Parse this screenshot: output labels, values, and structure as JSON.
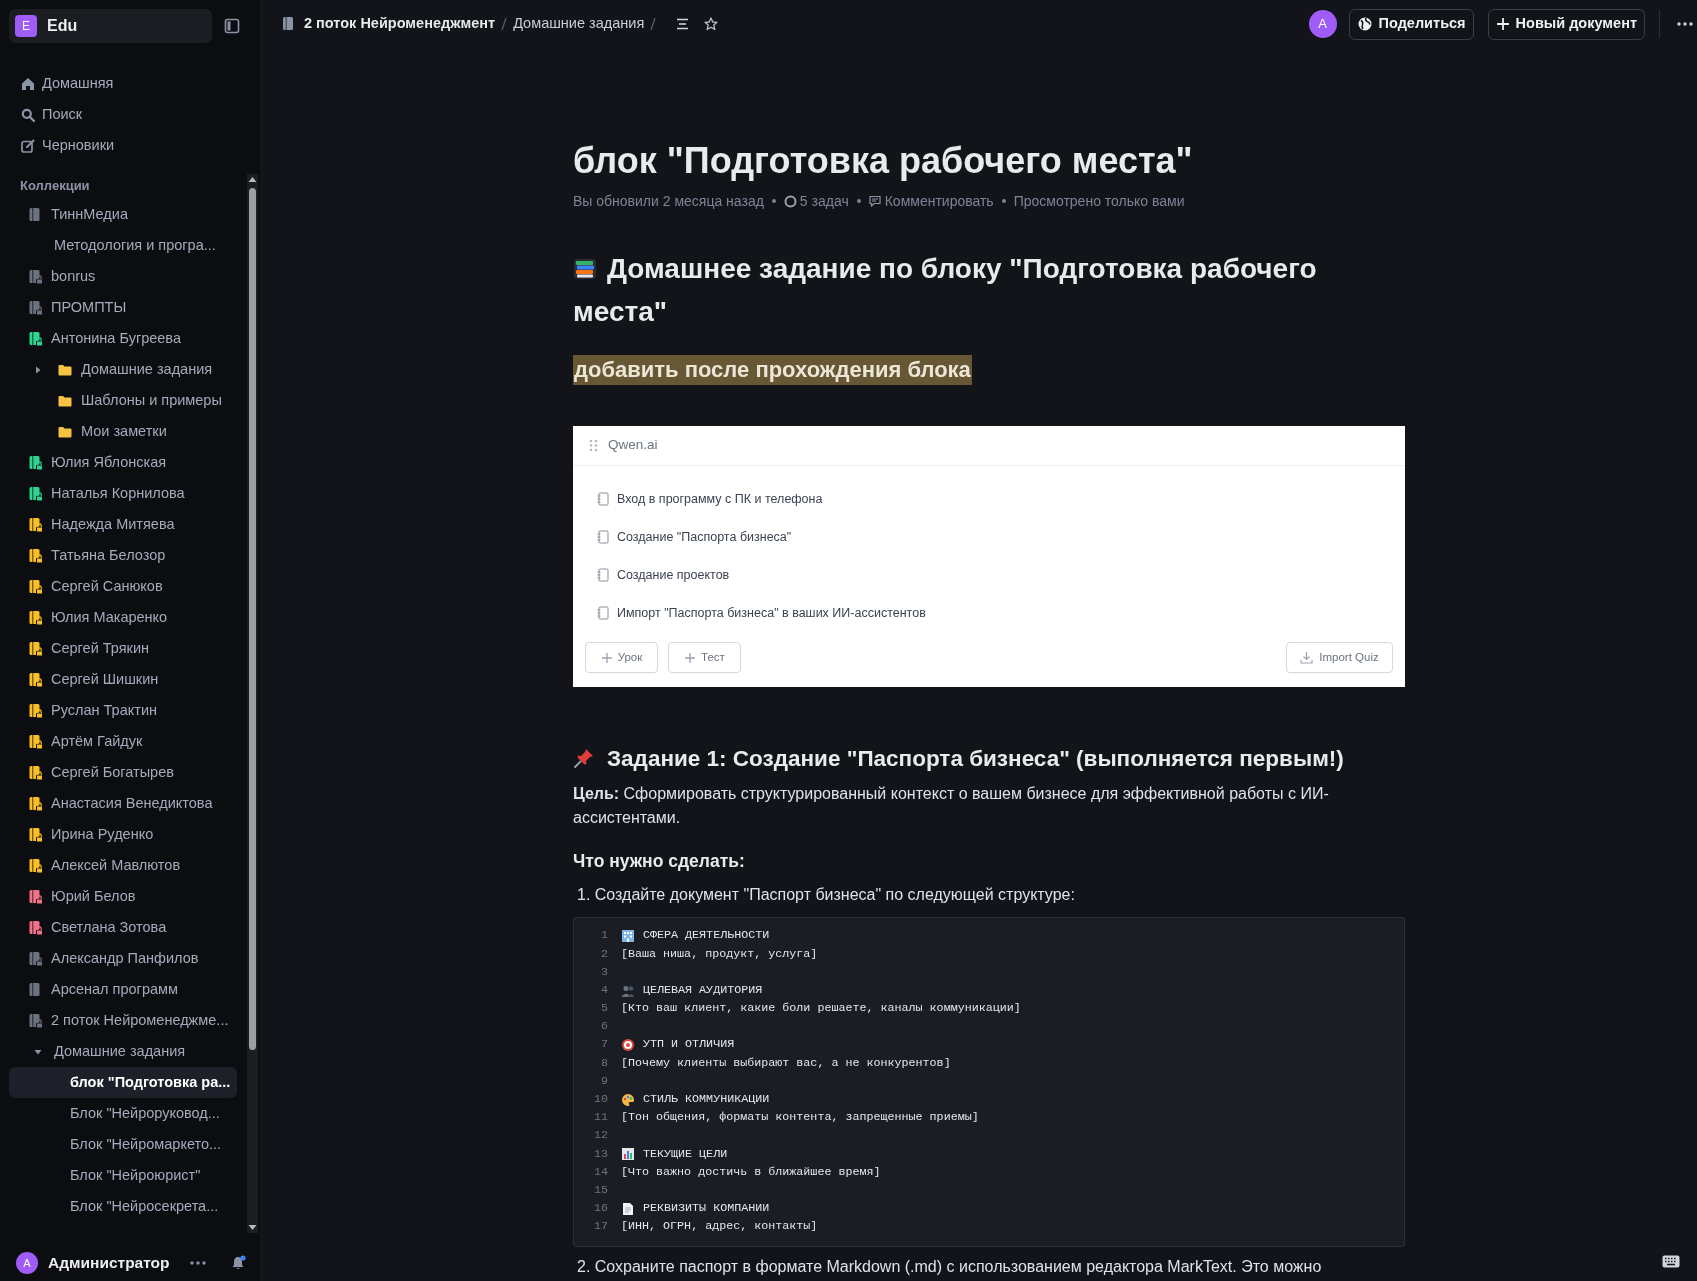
{
  "sidebar": {
    "workspace": {
      "initial": "E",
      "name": "Edu"
    },
    "nav": [
      {
        "label": "Домашняя",
        "kind": "home"
      },
      {
        "label": "Поиск",
        "kind": "search"
      },
      {
        "label": "Черновики",
        "kind": "drafts"
      }
    ],
    "collections_label": "Коллекции",
    "collections": [
      {
        "label": "ТиннМедиа",
        "kind": "collection",
        "color": "#6b7280",
        "locked": false,
        "selected": false,
        "children": [
          {
            "label": "Методология и програ...",
            "selected": false
          }
        ]
      },
      {
        "label": "bonrus",
        "kind": "collection",
        "color": "#6b7280",
        "locked": true,
        "selected": false
      },
      {
        "label": "ПРОМПТЫ",
        "kind": "collection",
        "color": "#6b7280",
        "locked": true,
        "selected": false
      },
      {
        "label": "Антонина Бугреева",
        "kind": "collection",
        "color": "#2dd48f",
        "locked": true,
        "selected": false,
        "children": [
          {
            "label": "Домашние задания",
            "kind": "folder",
            "expanded": false,
            "selected": false
          },
          {
            "label": "Шаблоны и примеры",
            "kind": "folder",
            "selected": false
          },
          {
            "label": "Мои заметки",
            "kind": "folder",
            "selected": false
          }
        ]
      },
      {
        "label": "Юлия Яблонская",
        "kind": "collection",
        "color": "#2dd48f",
        "locked": true,
        "selected": false
      },
      {
        "label": "Наталья Корнилова",
        "kind": "collection",
        "color": "#2dd48f",
        "locked": true,
        "selected": false
      },
      {
        "label": "Надежда Митяева",
        "kind": "collection",
        "color": "#fbbf24",
        "locked": true,
        "selected": false
      },
      {
        "label": "Татьяна Белозор",
        "kind": "collection",
        "color": "#fbbf24",
        "locked": true,
        "selected": false
      },
      {
        "label": "Сергей Санюков",
        "kind": "collection",
        "color": "#fbbf24",
        "locked": true,
        "selected": false
      },
      {
        "label": "Юлия Макаренко",
        "kind": "collection",
        "color": "#fbbf24",
        "locked": true,
        "selected": false
      },
      {
        "label": "Сергей Трякин",
        "kind": "collection",
        "color": "#fbbf24",
        "locked": true,
        "selected": false
      },
      {
        "label": "Сергей Шишкин",
        "kind": "collection",
        "color": "#fbbf24",
        "locked": true,
        "selected": false
      },
      {
        "label": "Руслан Трактин",
        "kind": "collection",
        "color": "#fbbf24",
        "locked": true,
        "selected": false
      },
      {
        "label": "Артём Гайдук",
        "kind": "collection",
        "color": "#fbbf24",
        "locked": true,
        "selected": false
      },
      {
        "label": "Сергей Богатырев",
        "kind": "collection",
        "color": "#fbbf24",
        "locked": true,
        "selected": false
      },
      {
        "label": "Анастасия Венедиктова",
        "kind": "collection",
        "color": "#fbbf24",
        "locked": true,
        "selected": false
      },
      {
        "label": "Ирина Руденко",
        "kind": "collection",
        "color": "#fbbf24",
        "locked": true,
        "selected": false
      },
      {
        "label": "Алексей Мавлютов",
        "kind": "collection",
        "color": "#fbbf24",
        "locked": true,
        "selected": false
      },
      {
        "label": "Юрий Белов",
        "kind": "collection",
        "color": "#f27189",
        "locked": true,
        "selected": false
      },
      {
        "label": "Светлана Зотова",
        "kind": "collection",
        "color": "#f27189",
        "locked": true,
        "selected": false
      },
      {
        "label": "Александр Панфилов",
        "kind": "collection",
        "color": "#6b7280",
        "locked": true,
        "selected": false
      },
      {
        "label": "Арсенал программ",
        "kind": "collection",
        "color": "#6b7280",
        "locked": false,
        "selected": false
      },
      {
        "label": "2 поток Нейроменеджме...",
        "kind": "collection",
        "color": "#6b7280",
        "locked": true,
        "selected": false,
        "children": [
          {
            "label": "Домашние задания",
            "expanded": true,
            "selected": false,
            "children": [
              {
                "label": "блок \"Подготовка ра...",
                "selected": true
              },
              {
                "label": "Блок \"Нейроруковод...",
                "selected": false
              },
              {
                "label": "Блок \"Нейромаркето...",
                "selected": false
              },
              {
                "label": "Блок \"Нейроюрист\"",
                "selected": false
              },
              {
                "label": "Блок \"Нейросекрета...",
                "selected": false
              }
            ]
          }
        ]
      }
    ],
    "user": {
      "initial": "A",
      "name": "Администратор",
      "notification": true
    }
  },
  "header": {
    "breadcrumbs": [
      {
        "label": "2 поток Нейроменеджмент",
        "kind": "collection"
      },
      {
        "label": "Домашние задания"
      }
    ],
    "avatar": "A",
    "share_button": "Поделиться",
    "new_button": "Новый документ"
  },
  "document": {
    "title": "блок \"Подготовка рабочего места\"",
    "meta": [
      {
        "text": "Вы обновили 2 месяца назад",
        "kind": "plain"
      },
      {
        "text": "5 задач",
        "kind": "tasks"
      },
      {
        "text": "Комментировать",
        "kind": "comment"
      },
      {
        "text": "Просмотрено только вами",
        "kind": "plain"
      }
    ],
    "blocks": [
      {
        "kind": "heading1",
        "text": "Домашнее задание по блоку \"Подготовка рабочего места\""
      },
      {
        "kind": "highlight",
        "text": "добавить после прохождения блока"
      },
      {
        "kind": "embed",
        "title": "Qwen.ai",
        "lessons": [
          "Вход в программу с ПК и телефона",
          "Создание \"Паспорта бизнеса\"",
          "Создание проектов",
          "Импорт \"Паспорта бизнеса\" в ваших ИИ-ассистентов"
        ],
        "buttons": [
          "Урок",
          "Тест"
        ],
        "import_button": "Import Quiz"
      },
      {
        "kind": "heading2",
        "text": "Задание 1: Создание \"Паспорта бизнеса\" (выполняется первым!)"
      },
      {
        "kind": "paragraph",
        "text": "**Цель:** Сформировать структурированный контекст о вашем бизнесе для эффективной работы с ИИ-ассистентами."
      },
      {
        "kind": "heading3",
        "text": "Что нужно сделать:"
      },
      {
        "kind": "list_item",
        "text": "1. Создайте документ \"Паспорт бизнеса\" по следующей структуре:"
      },
      {
        "kind": "code",
        "lines": [
          {
            "number": "1",
            "kind": "heading",
            "text": "СФЕРА ДЕЯТЕЛЬНОСТИ"
          },
          {
            "number": "2",
            "kind": "text",
            "text": "[Ваша ниша, продукт, услуга]"
          },
          {
            "number": "3",
            "kind": "blank"
          },
          {
            "number": "4",
            "kind": "heading",
            "text": "ЦЕЛЕВАЯ АУДИТОРИЯ"
          },
          {
            "number": "5",
            "kind": "text",
            "text": "[Кто ваш клиент, какие боли решаете, каналы коммуникации]"
          },
          {
            "number": "6",
            "kind": "blank"
          },
          {
            "number": "7",
            "kind": "heading",
            "text": "УТП И ОТЛИЧИЯ"
          },
          {
            "number": "8",
            "kind": "text",
            "text": "[Почему клиенты выбирают вас, а не конкурентов]"
          },
          {
            "number": "9",
            "kind": "blank"
          },
          {
            "number": "10",
            "kind": "heading",
            "text": "СТИЛЬ КОММУНИКАЦИИ"
          },
          {
            "number": "11",
            "kind": "text",
            "text": "[Тон общения, форматы контента, запрещенные приемы]"
          },
          {
            "number": "12",
            "kind": "blank"
          },
          {
            "number": "13",
            "kind": "heading",
            "text": "ТЕКУЩИЕ ЦЕЛИ"
          },
          {
            "number": "14",
            "kind": "text",
            "text": "[Что важно достичь в ближайшее время]"
          },
          {
            "number": "15",
            "kind": "blank"
          },
          {
            "number": "16",
            "kind": "heading",
            "text": "РЕКВИЗИТЫ КОМПАНИИ"
          },
          {
            "number": "17",
            "kind": "text",
            "text": "[ИНН, ОГРН, адрес, контакты]"
          }
        ]
      },
      {
        "kind": "list_item",
        "text": "2. Сохраните паспорт в формате Markdown (.md) с использованием редактора MarkText. Это можно"
      }
    ]
  }
}
